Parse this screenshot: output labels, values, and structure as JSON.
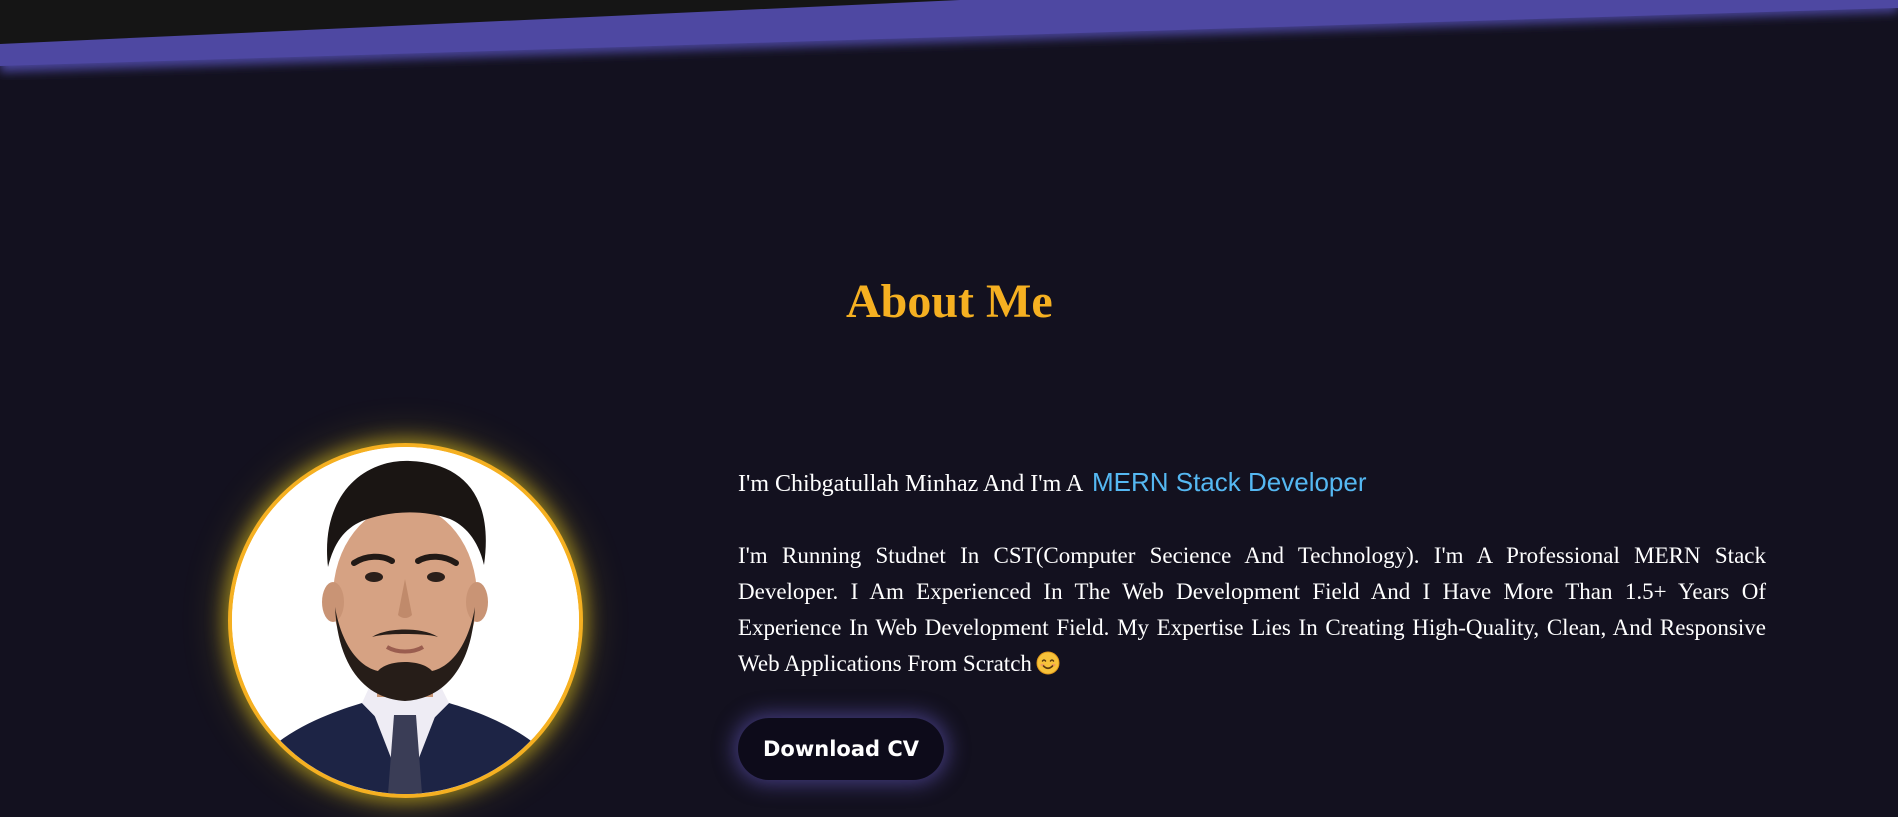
{
  "about": {
    "title": "About Me",
    "intro_prefix": "I'm Chibgatullah Minhaz And I'm A",
    "intro_role": "MERN Stack Developer",
    "bio": "I'm Running Studnet In CST(Computer Secience And Technology). I'm A Professional MERN Stack Developer. I Am Experienced In The Web Development Field And I Have More Than 1.5+ Years Of Experience In Web Development Field. My Expertise Lies In Creating High-Quality, Clean, And Responsive Web Applications From Scratch",
    "download_label": "Download CV"
  },
  "icons": {
    "emoji": "smiling-face-emoji"
  },
  "colors": {
    "background": "#13111f",
    "accent": "#f5b021",
    "role_highlight": "#55b8f2",
    "band": "#4a449a",
    "button_bg": "#0d0b1a"
  }
}
